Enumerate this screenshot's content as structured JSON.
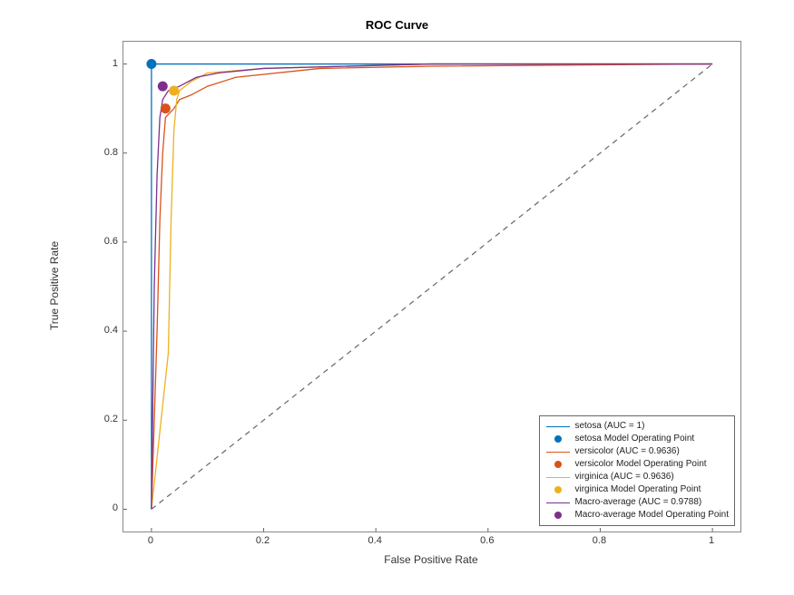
{
  "chart_data": {
    "type": "line",
    "title": "ROC Curve",
    "xlabel": "False Positive Rate",
    "ylabel": "True Positive Rate",
    "xlim": [
      -0.05,
      1.05
    ],
    "ylim": [
      -0.05,
      1.05
    ],
    "xticks": [
      0,
      0.2,
      0.4,
      0.6,
      0.8,
      1
    ],
    "yticks": [
      0,
      0.2,
      0.4,
      0.6,
      0.8,
      1
    ],
    "diagonal": {
      "x": [
        0,
        1
      ],
      "y": [
        0,
        1
      ],
      "style": "dashed",
      "color": "#666"
    },
    "series": [
      {
        "name": "setosa (AUC = 1)",
        "color": "#0072BD",
        "x": [
          0,
          0,
          1
        ],
        "y": [
          0,
          1,
          1
        ]
      },
      {
        "name": "versicolor (AUC = 0.9636)",
        "color": "#D95319",
        "x": [
          0,
          0.01,
          0.015,
          0.02,
          0.025,
          0.04,
          0.05,
          0.07,
          0.1,
          0.15,
          0.3,
          0.5,
          1.0
        ],
        "y": [
          0,
          0.4,
          0.65,
          0.8,
          0.88,
          0.9,
          0.92,
          0.93,
          0.95,
          0.97,
          0.99,
          0.995,
          1.0
        ]
      },
      {
        "name": "virginica (AUC = 0.9636)",
        "color": "#EDB120",
        "x": [
          0,
          0.03,
          0.035,
          0.04,
          0.045,
          0.05,
          0.07,
          0.1,
          0.2,
          0.5,
          1.0
        ],
        "y": [
          0,
          0.35,
          0.65,
          0.85,
          0.92,
          0.94,
          0.96,
          0.98,
          0.99,
          1.0,
          1.0
        ]
      },
      {
        "name": "Macro-average (AUC = 0.9788)",
        "color": "#7E2F8E",
        "x": [
          0,
          0.005,
          0.01,
          0.015,
          0.02,
          0.03,
          0.05,
          0.08,
          0.12,
          0.2,
          0.5,
          1.0
        ],
        "y": [
          0,
          0.5,
          0.75,
          0.88,
          0.92,
          0.94,
          0.95,
          0.97,
          0.98,
          0.99,
          1.0,
          1.0
        ]
      }
    ],
    "operating_points": [
      {
        "name": "setosa Model Operating Point",
        "color": "#0072BD",
        "x": 0.0,
        "y": 1.0
      },
      {
        "name": "versicolor Model Operating Point",
        "color": "#D95319",
        "x": 0.025,
        "y": 0.9
      },
      {
        "name": "virginica Model Operating Point",
        "color": "#EDB120",
        "x": 0.04,
        "y": 0.94
      },
      {
        "name": "Macro-average Model Operating Point",
        "color": "#7E2F8E",
        "x": 0.02,
        "y": 0.95
      }
    ],
    "legend_entries": [
      {
        "type": "line",
        "color": "#0072BD",
        "label": "setosa (AUC = 1)"
      },
      {
        "type": "dot",
        "color": "#0072BD",
        "label": "setosa Model Operating Point"
      },
      {
        "type": "line",
        "color": "#D95319",
        "label": "versicolor (AUC = 0.9636)"
      },
      {
        "type": "dot",
        "color": "#D95319",
        "label": "versicolor Model Operating Point"
      },
      {
        "type": "line",
        "color": "#EDB120",
        "label": "virginica (AUC = 0.9636)"
      },
      {
        "type": "dot",
        "color": "#EDB120",
        "label": "virginica Model Operating Point"
      },
      {
        "type": "line",
        "color": "#7E2F8E",
        "label": "Macro-average (AUC = 0.9788)"
      },
      {
        "type": "dot",
        "color": "#7E2F8E",
        "label": "Macro-average Model Operating Point"
      }
    ]
  }
}
